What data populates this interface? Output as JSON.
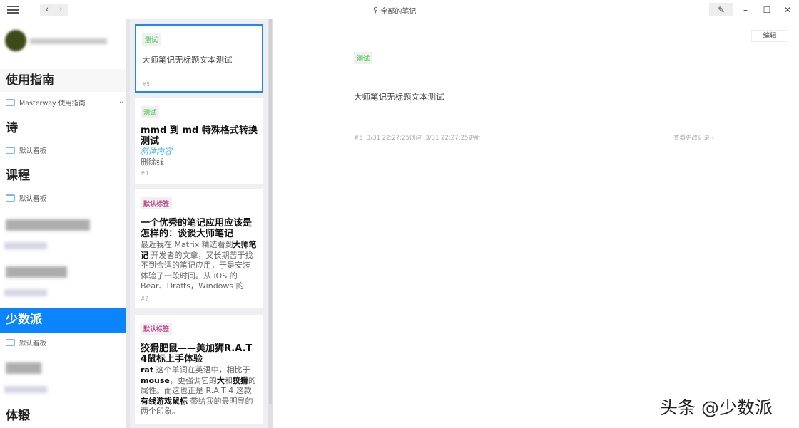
{
  "header": {
    "search_label": "全部的笔记",
    "back": "‹",
    "forward": "›",
    "compose_icon": "compose-icon",
    "minimize": "–",
    "maximize": "☐",
    "close": "✕"
  },
  "sidebar": {
    "sections": [
      {
        "title": "使用指南",
        "items": [
          {
            "label": "Masterway 使用指南",
            "more": "···"
          }
        ]
      },
      {
        "title": "诗",
        "items": [
          {
            "label": "默认看板"
          }
        ]
      },
      {
        "title": "课程",
        "items": [
          {
            "label": "默认看板"
          }
        ]
      },
      {
        "title": "少数派",
        "items": [
          {
            "label": "默认看板"
          }
        ],
        "selected": true
      },
      {
        "title": "体锻"
      }
    ]
  },
  "notes": [
    {
      "tag": "测试",
      "title": "大师笔记无标题文本测试",
      "num": "#5"
    },
    {
      "tag": "测试",
      "title": "mmd 到 md 特殊格式转换测试",
      "italic": "斜体内容",
      "strike": "删除线",
      "num": "#4"
    },
    {
      "tag": "默认标签",
      "title": "一个优秀的笔记应用应该是怎样的：谈谈大师笔记",
      "b1": "最近我在 Matrix 精选看到",
      "b2": "大师笔记",
      "b3": " 开发者的文章，又长期苦于找不到合适的笔记应用，于是安装体验了一段时间。从 iOS 的 Bear、Drafts，Windows 的 Evernote 到今天的 Notion",
      "num": "#2"
    },
    {
      "tag": "默认标签",
      "title": "狡猾肥鼠——美加狮R.A.T 4鼠标上手体验",
      "b1": "rat",
      "b2": " 这个单词在英语中，相比于 ",
      "b3": "mouse",
      "b4": "，更强调它的",
      "b5": "大",
      "b6": "和",
      "b7": "狡猾",
      "b8": "的属性。而这也正是 R.A.T 4 这款",
      "b9": "有线游戏鼠标",
      "b10": " 带给我的最明显的两个印象。"
    }
  ],
  "detail": {
    "edit_label": "编辑",
    "tag": "测试",
    "body": "大师笔记无标题文本测试",
    "meta": "#5  3/31 22:27:25创建  3/31 22:27:25更新",
    "history": "查看更改记录 ›"
  },
  "watermark": "头条 @少数派",
  "colors": {
    "accent": "#0a84ff",
    "tag_green": "#6fd36f",
    "tag_pink": "#c0488a"
  }
}
